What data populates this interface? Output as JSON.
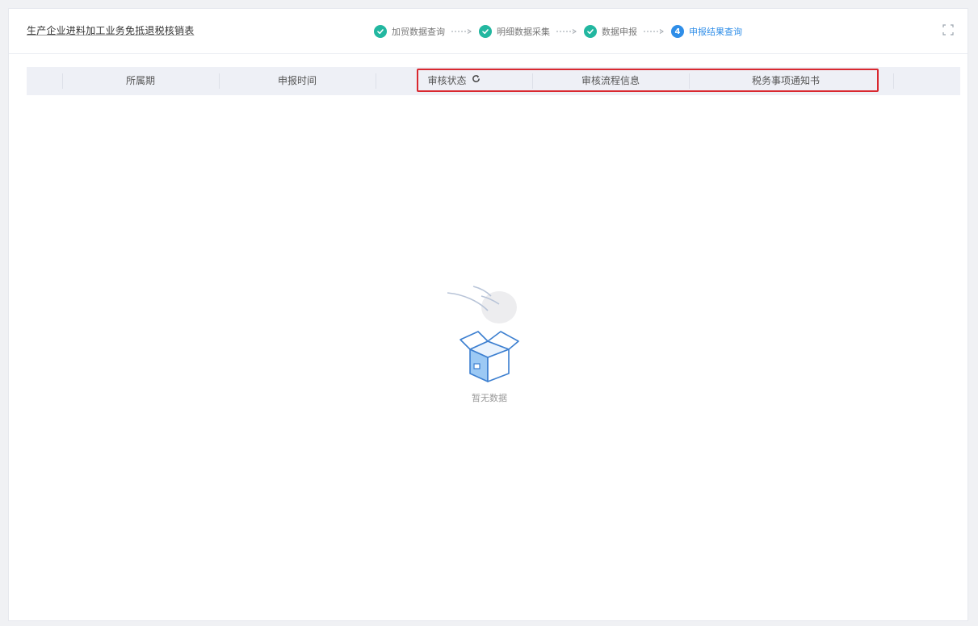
{
  "header": {
    "title": "生产企业进料加工业务免抵退税核销表"
  },
  "steps": [
    {
      "label": "加贸数据查询",
      "status": "done"
    },
    {
      "label": "明细数据采集",
      "status": "done"
    },
    {
      "label": "数据申报",
      "status": "done"
    },
    {
      "label": "申报结果查询",
      "status": "active",
      "number": "4"
    }
  ],
  "table": {
    "columns": [
      "所属期",
      "申报时间",
      "审核状态",
      "审核流程信息",
      "税务事项通知书"
    ]
  },
  "empty_state": {
    "text": "暂无数据"
  },
  "icons": {
    "step_done": "check-circle-icon",
    "refresh": "refresh-icon",
    "fullscreen": "fullscreen-icon",
    "empty": "empty-box-icon"
  },
  "colors": {
    "step_done": "#22b7a0",
    "step_active": "#2f8ee8",
    "highlight_border": "#d9282f",
    "header_bg": "#eef0f6"
  }
}
